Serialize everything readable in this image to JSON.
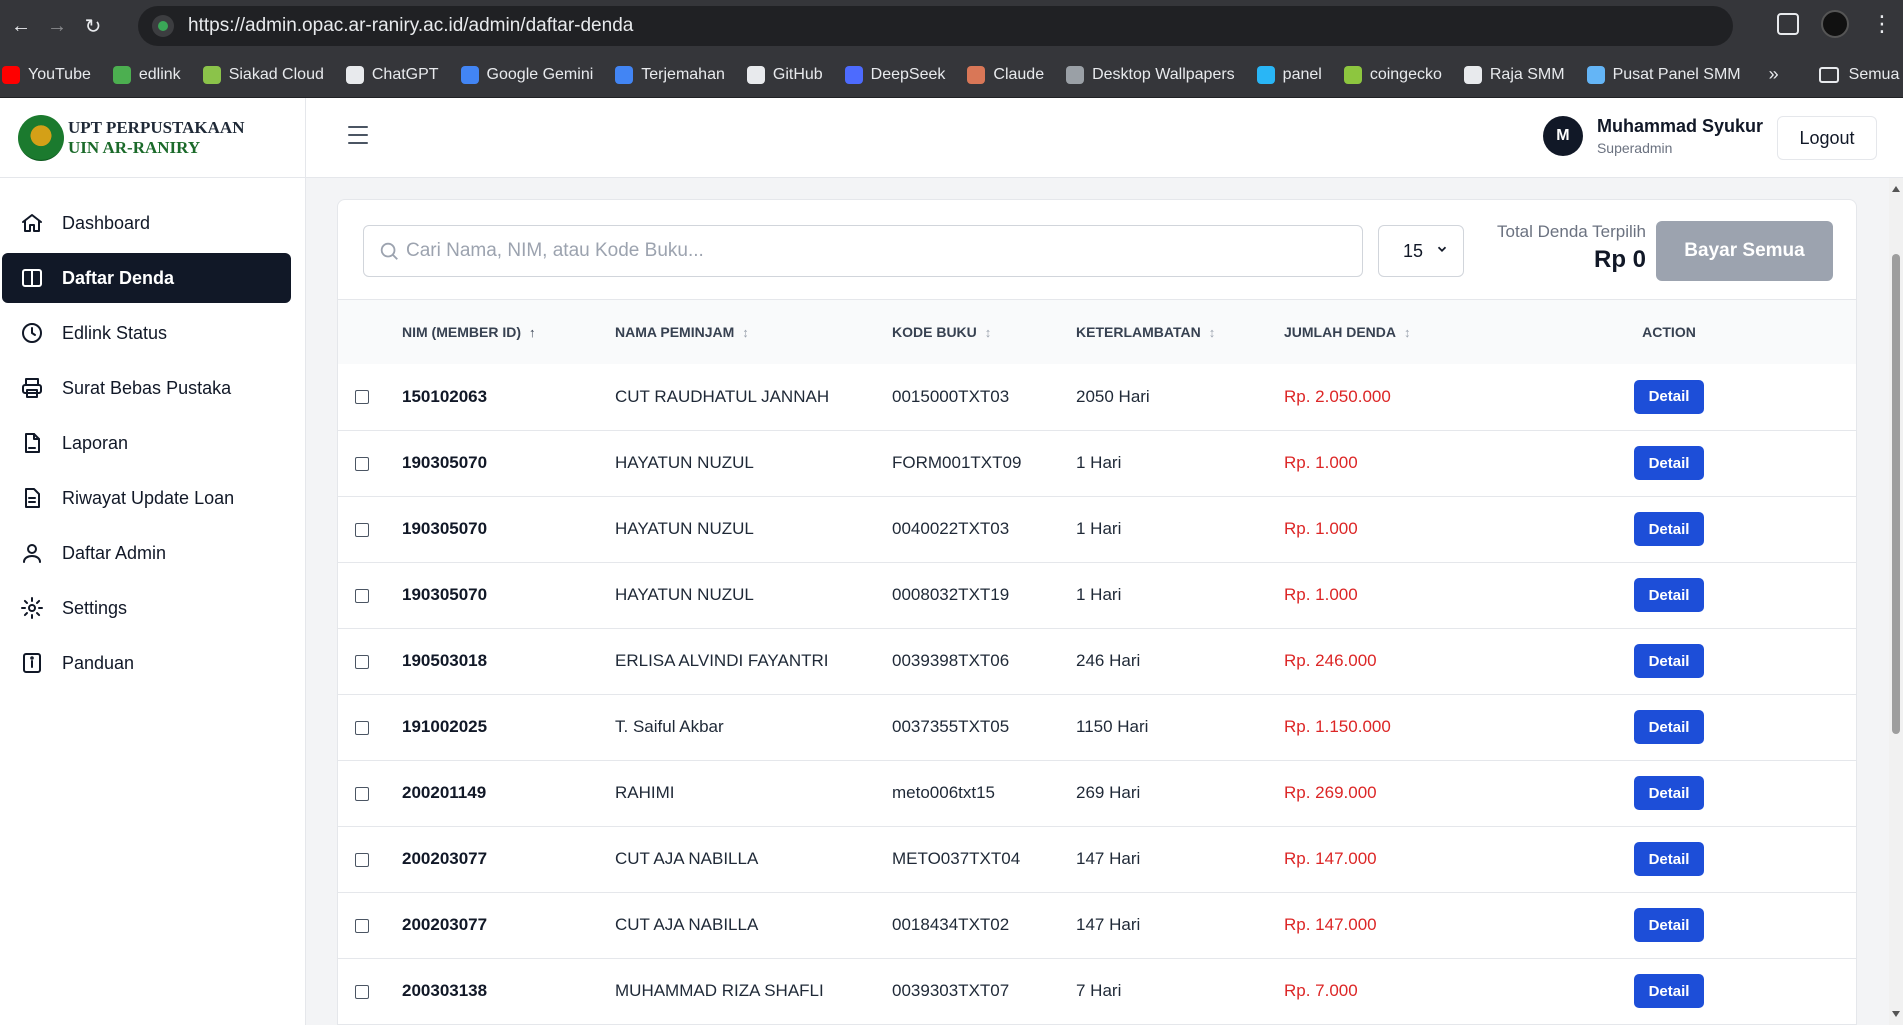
{
  "browser": {
    "url": "https://admin.opac.ar-raniry.ac.id/admin/daftar-denda",
    "bookmarks": [
      {
        "label": "YouTube",
        "color": "#ff0000"
      },
      {
        "label": "edlink",
        "color": "#4caf50"
      },
      {
        "label": "Siakad Cloud",
        "color": "#8bc34a"
      },
      {
        "label": "ChatGPT",
        "color": "#e8eaed"
      },
      {
        "label": "Google Gemini",
        "color": "#4285f4"
      },
      {
        "label": "Terjemahan",
        "color": "#4285f4"
      },
      {
        "label": "GitHub",
        "color": "#e8eaed"
      },
      {
        "label": "DeepSeek",
        "color": "#4d6bfe"
      },
      {
        "label": "Claude",
        "color": "#d97757"
      },
      {
        "label": "Desktop Wallpapers",
        "color": "#9aa0a6"
      },
      {
        "label": "panel",
        "color": "#29b6f6"
      },
      {
        "label": "coingecko",
        "color": "#8dc63f"
      },
      {
        "label": "Raja SMM",
        "color": "#e8eaed"
      },
      {
        "label": "Pusat Panel SMM",
        "color": "#64b5f6"
      }
    ],
    "all_bookmarks_label": "Semua Bookmark"
  },
  "brand": {
    "line1": "UPT PERPUSTAKAAN",
    "line2": "UIN AR-RANIRY"
  },
  "sidebar": {
    "items": [
      {
        "label": "Dashboard",
        "icon": "home-icon",
        "active": false
      },
      {
        "label": "Daftar Denda",
        "icon": "book-open-icon",
        "active": true
      },
      {
        "label": "Edlink Status",
        "icon": "clock-icon",
        "active": false
      },
      {
        "label": "Surat Bebas Pustaka",
        "icon": "printer-icon",
        "active": false
      },
      {
        "label": "Laporan",
        "icon": "document-icon",
        "active": false
      },
      {
        "label": "Riwayat Update Loan",
        "icon": "document-text-icon",
        "active": false
      },
      {
        "label": "Daftar Admin",
        "icon": "user-icon",
        "active": false
      },
      {
        "label": "Settings",
        "icon": "gear-icon",
        "active": false
      },
      {
        "label": "Panduan",
        "icon": "info-icon",
        "active": false
      }
    ]
  },
  "header": {
    "avatar_initial": "M",
    "user_name": "Muhammad Syukur",
    "user_role": "Superadmin",
    "logout_label": "Logout"
  },
  "filters": {
    "search_placeholder": "Cari Nama, NIM, atau Kode Buku...",
    "per_page": "15",
    "total_label": "Total Denda Terpilih",
    "total_value": "Rp 0",
    "pay_all_label": "Bayar Semua"
  },
  "table": {
    "columns": [
      "NIM (MEMBER ID)",
      "NAMA PEMINJAM",
      "KODE BUKU",
      "KETERLAMBATAN",
      "JUMLAH DENDA",
      "ACTION"
    ],
    "detail_label": "Detail",
    "rows": [
      {
        "nim": "150102063",
        "name": "CUT RAUDHATUL JANNAH",
        "code": "0015000TXT03",
        "late": "2050 Hari",
        "fine": "Rp. 2.050.000"
      },
      {
        "nim": "190305070",
        "name": "HAYATUN NUZUL",
        "code": "FORM001TXT09",
        "late": "1 Hari",
        "fine": "Rp. 1.000"
      },
      {
        "nim": "190305070",
        "name": "HAYATUN NUZUL",
        "code": "0040022TXT03",
        "late": "1 Hari",
        "fine": "Rp. 1.000"
      },
      {
        "nim": "190305070",
        "name": "HAYATUN NUZUL",
        "code": "0008032TXT19",
        "late": "1 Hari",
        "fine": "Rp. 1.000"
      },
      {
        "nim": "190503018",
        "name": "ERLISA ALVINDI FAYANTRI",
        "code": "0039398TXT06",
        "late": "246 Hari",
        "fine": "Rp. 246.000"
      },
      {
        "nim": "191002025",
        "name": "T. Saiful Akbar",
        "code": "0037355TXT05",
        "late": "1150 Hari",
        "fine": "Rp. 1.150.000"
      },
      {
        "nim": "200201149",
        "name": "RAHIMI",
        "code": "meto006txt15",
        "late": "269 Hari",
        "fine": "Rp. 269.000"
      },
      {
        "nim": "200203077",
        "name": "CUT AJA NABILLA",
        "code": "METO037TXT04",
        "late": "147 Hari",
        "fine": "Rp. 147.000"
      },
      {
        "nim": "200203077",
        "name": "CUT AJA NABILLA",
        "code": "0018434TXT02",
        "late": "147 Hari",
        "fine": "Rp. 147.000"
      },
      {
        "nim": "200303138",
        "name": "MUHAMMAD RIZA SHAFLI",
        "code": "0039303TXT07",
        "late": "7 Hari",
        "fine": "Rp. 7.000"
      }
    ]
  },
  "colors": {
    "accent": "#1d4ed8",
    "fine_text": "#dc2626",
    "sidebar_active": "#111827"
  }
}
